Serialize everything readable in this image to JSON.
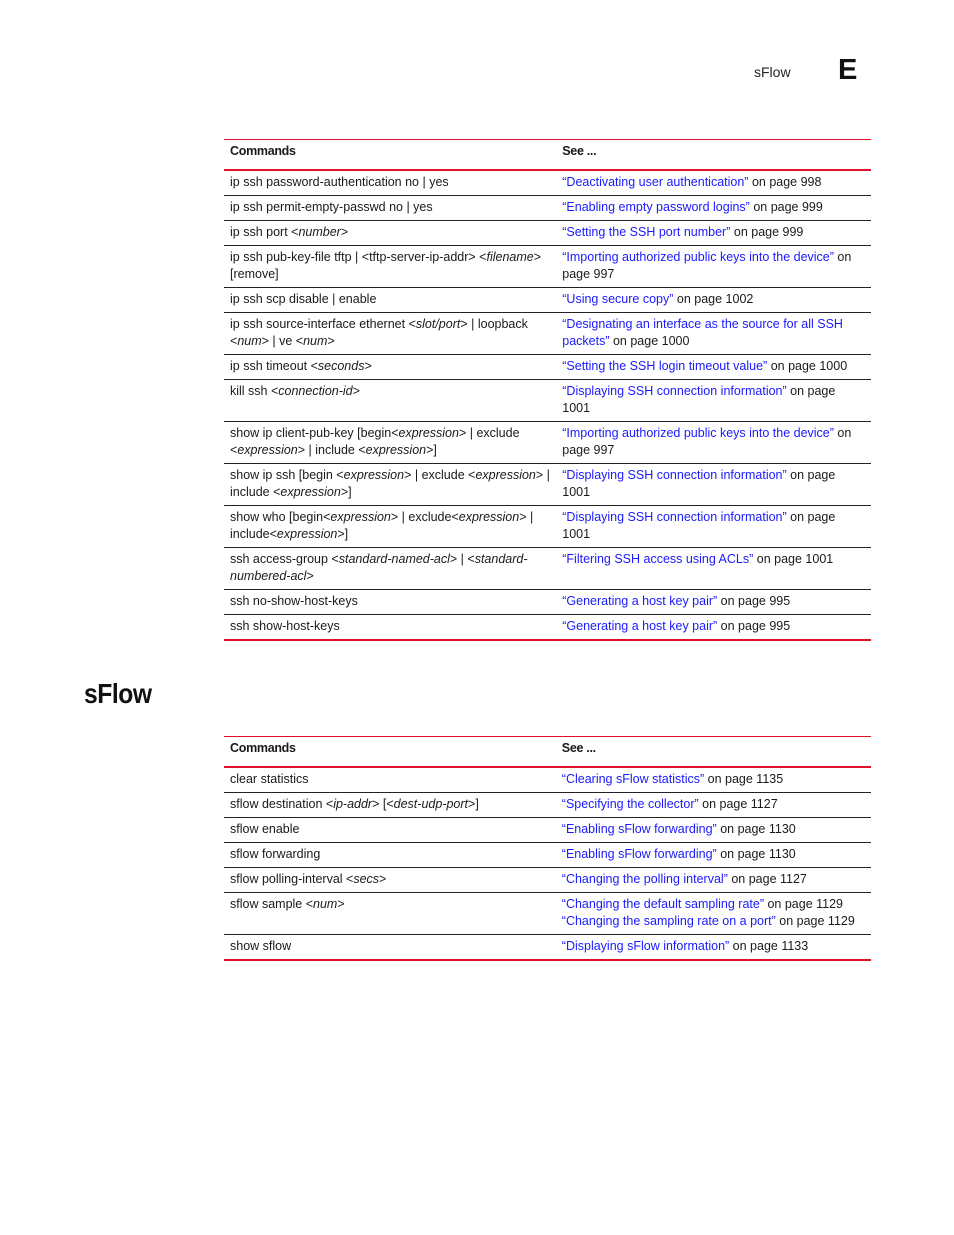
{
  "header": {
    "running_title": "sFlow",
    "chapter_letter": "E"
  },
  "tables": {
    "ssh": {
      "columns": [
        "Commands",
        "See ..."
      ],
      "rows": [
        {
          "command": [
            {
              "t": "ip ssh password-authentication no | yes"
            }
          ],
          "refs": [
            {
              "link": "“Deactivating user authentication”",
              "suffix": " on page 998"
            }
          ]
        },
        {
          "command": [
            {
              "t": "ip ssh permit-empty-passwd no | yes"
            }
          ],
          "refs": [
            {
              "link": "“Enabling empty password logins”",
              "suffix": " on page 999"
            }
          ]
        },
        {
          "command": [
            {
              "t": "ip ssh port <"
            },
            {
              "t": "number",
              "i": true
            },
            {
              "t": ">"
            }
          ],
          "refs": [
            {
              "link": "“Setting the SSH port number”",
              "suffix": " on page 999"
            }
          ]
        },
        {
          "command": [
            {
              "t": "ip ssh pub-key-file tftp | <tftp-server-ip-addr> <"
            },
            {
              "t": "filename",
              "i": true
            },
            {
              "t": "> [remove]"
            }
          ],
          "refs": [
            {
              "link": "“Importing authorized public keys into the device”",
              "suffix": " on page 997"
            }
          ]
        },
        {
          "command": [
            {
              "t": "ip ssh scp disable | enable"
            }
          ],
          "refs": [
            {
              "link": "“Using secure copy”",
              "suffix": " on page 1002"
            }
          ]
        },
        {
          "command": [
            {
              "t": "ip ssh source-interface ethernet <"
            },
            {
              "t": "slot/port",
              "i": true
            },
            {
              "t": "> | loopback <"
            },
            {
              "t": "num",
              "i": true
            },
            {
              "t": "> | ve <"
            },
            {
              "t": "num",
              "i": true
            },
            {
              "t": ">"
            }
          ],
          "refs": [
            {
              "link": "“Designating an interface as the source for all SSH packets”",
              "suffix": " on page 1000"
            }
          ]
        },
        {
          "command": [
            {
              "t": "ip ssh timeout <"
            },
            {
              "t": "seconds",
              "i": true
            },
            {
              "t": ">"
            }
          ],
          "refs": [
            {
              "link": "“Setting the SSH login timeout value”",
              "suffix": " on page 1000"
            }
          ]
        },
        {
          "command": [
            {
              "t": "kill ssh <"
            },
            {
              "t": "connection-id",
              "i": true
            },
            {
              "t": ">"
            }
          ],
          "refs": [
            {
              "link": "“Displaying SSH connection information”",
              "suffix": " on page 1001"
            }
          ]
        },
        {
          "command": [
            {
              "t": "show ip client-pub-key [begin<"
            },
            {
              "t": "expression",
              "i": true
            },
            {
              "t": "> | exclude <"
            },
            {
              "t": "expression",
              "i": true
            },
            {
              "t": "> | include <"
            },
            {
              "t": "expression",
              "i": true
            },
            {
              "t": ">]"
            }
          ],
          "refs": [
            {
              "link": "“Importing authorized public keys into the device”",
              "suffix": " on page 997"
            }
          ]
        },
        {
          "command": [
            {
              "t": "show ip ssh [begin <"
            },
            {
              "t": "expression",
              "i": true
            },
            {
              "t": "> | exclude <"
            },
            {
              "t": "expression",
              "i": true
            },
            {
              "t": "> | include <"
            },
            {
              "t": "expression",
              "i": true
            },
            {
              "t": ">]"
            }
          ],
          "refs": [
            {
              "link": "“Displaying SSH connection information”",
              "suffix": " on page 1001"
            }
          ]
        },
        {
          "command": [
            {
              "t": "show who [begin<"
            },
            {
              "t": "expression",
              "i": true
            },
            {
              "t": "> | exclude<"
            },
            {
              "t": "expression",
              "i": true
            },
            {
              "t": "> | include<"
            },
            {
              "t": "expression",
              "i": true
            },
            {
              "t": ">]"
            }
          ],
          "refs": [
            {
              "link": "“Displaying SSH connection information”",
              "suffix": " on page 1001"
            }
          ]
        },
        {
          "command": [
            {
              "t": "ssh access-group <"
            },
            {
              "t": "standard-named-acl",
              "i": true
            },
            {
              "t": "> | <"
            },
            {
              "t": "standard-numbered-acl",
              "i": true
            },
            {
              "t": ">"
            }
          ],
          "refs": [
            {
              "link": "“Filtering SSH access using ACLs”",
              "suffix": " on page 1001"
            }
          ]
        },
        {
          "command": [
            {
              "t": "ssh no-show-host-keys"
            }
          ],
          "refs": [
            {
              "link": "“Generating a host key pair”",
              "suffix": " on page 995"
            }
          ]
        },
        {
          "command": [
            {
              "t": "ssh show-host-keys"
            }
          ],
          "refs": [
            {
              "link": "“Generating a host key pair”",
              "suffix": " on page 995"
            }
          ]
        }
      ]
    },
    "sflow": {
      "section_title": "sFlow",
      "columns": [
        "Commands",
        "See ..."
      ],
      "rows": [
        {
          "command": [
            {
              "t": "clear statistics"
            }
          ],
          "refs": [
            {
              "link": "“Clearing sFlow statistics”",
              "suffix": " on page 1135"
            }
          ]
        },
        {
          "command": [
            {
              "t": "sflow destination <"
            },
            {
              "t": "ip-addr",
              "i": true
            },
            {
              "t": "> [<"
            },
            {
              "t": "dest-udp-port",
              "i": true
            },
            {
              "t": ">]"
            }
          ],
          "refs": [
            {
              "link": "“Specifying the collector”",
              "suffix": " on page 1127"
            }
          ]
        },
        {
          "command": [
            {
              "t": "sflow enable"
            }
          ],
          "refs": [
            {
              "link": "“Enabling sFlow forwarding”",
              "suffix": " on page 1130"
            }
          ]
        },
        {
          "command": [
            {
              "t": "sflow forwarding"
            }
          ],
          "refs": [
            {
              "link": "“Enabling sFlow forwarding”",
              "suffix": " on page 1130"
            }
          ]
        },
        {
          "command": [
            {
              "t": "sflow polling-interval <"
            },
            {
              "t": "secs",
              "i": true
            },
            {
              "t": ">"
            }
          ],
          "refs": [
            {
              "link": "“Changing the polling interval”",
              "suffix": " on page 1127"
            }
          ]
        },
        {
          "command": [
            {
              "t": "sflow sample <"
            },
            {
              "t": "num",
              "i": true
            },
            {
              "t": ">"
            }
          ],
          "refs": [
            {
              "link": "“Changing the default sampling rate”",
              "suffix": " on page 1129"
            },
            {
              "link": "“Changing the sampling rate on a port”",
              "suffix": " on page 1129"
            }
          ]
        },
        {
          "command": [
            {
              "t": "show sflow"
            }
          ],
          "refs": [
            {
              "link": "“Displaying sFlow information”",
              "suffix": " on page 1133"
            }
          ]
        }
      ]
    }
  },
  "colors": {
    "rule_red": "#e0102a",
    "link_blue": "#1a1aff"
  }
}
